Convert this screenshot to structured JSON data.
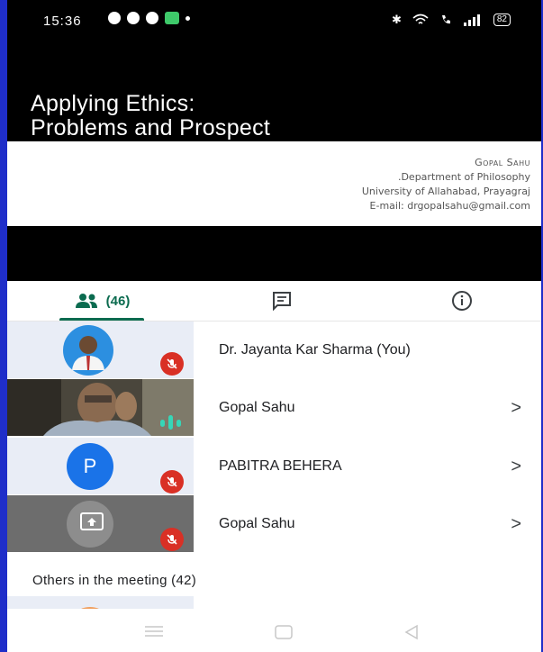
{
  "status_bar": {
    "time": "15:36",
    "battery": "82"
  },
  "slide": {
    "title_line1": "Applying Ethics:",
    "title_line2": "Problems and Prospect",
    "author_name": "Gopal Sahu",
    "author_dept": ".Department of Philosophy",
    "author_univ": "University of Allahabad, Prayagraj",
    "author_email": "E-mail: drgopalsahu@gmail.com"
  },
  "tabs": {
    "people_count": "(46)"
  },
  "participants": [
    {
      "name": "Dr. Jayanta Kar Sharma (You)"
    },
    {
      "name": "Gopal Sahu"
    },
    {
      "name": "PABITRA BEHERA",
      "initial": "P"
    },
    {
      "name": "Gopal Sahu"
    }
  ],
  "others_label": "Others in the meeting (42)",
  "icons": {
    "people": "people-icon",
    "chat": "chat-icon",
    "info": "info-icon",
    "mic_off": "mic-off-icon",
    "chevron": "chevron-right-icon",
    "present": "present-screen-icon",
    "audio": "audio-level-icon"
  },
  "colors": {
    "frame_border": "#1f2ec9",
    "accent": "#0b6b4f",
    "mute_red": "#d93025",
    "avatar_blue": "#1a73e8"
  }
}
